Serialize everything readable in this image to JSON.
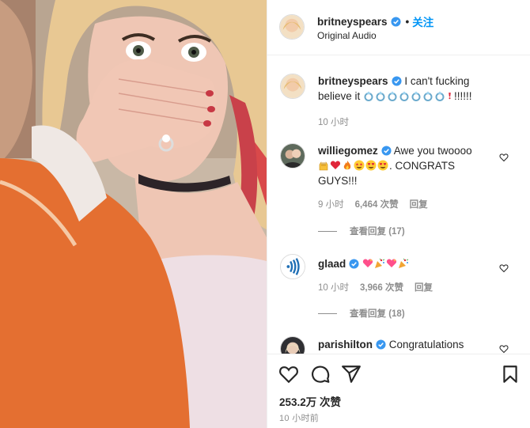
{
  "post": {
    "username": "britneyspears",
    "follow_label": "关注",
    "separator": "•",
    "audio_label": "Original Audio"
  },
  "comments": [
    {
      "user": "britneyspears",
      "text_prefix": "I can't fucking believe it ",
      "emoji": [
        "ring-icon",
        "ring-icon",
        "ring-icon",
        "ring-icon",
        "ring-icon",
        "ring-icon",
        "ring-icon",
        "exclamation-icon"
      ],
      "text_suffix": "!!!!!!",
      "time": "10 小时"
    },
    {
      "user": "williegomez",
      "text_prefix": "Awe you twoooo ",
      "emoji": [
        "raised-hands-icon",
        "red-heart-icon",
        "fire-icon",
        "star-struck-icon",
        "heart-eyes-icon",
        "heart-eyes-icon"
      ],
      "text_suffix": ". CONGRATS GUYS!!!",
      "time": "9 小时",
      "likes": "6,464 次赞",
      "reply": "回复",
      "view_replies": "查看回复 (17)"
    },
    {
      "user": "glaad",
      "text_prefix": "",
      "emoji": [
        "sparkling-heart-icon",
        "party-popper-icon",
        "sparkling-heart-icon",
        "party-popper-icon"
      ],
      "text_suffix": "",
      "time": "10 小时",
      "likes": "3,966 次赞",
      "reply": "回复",
      "view_replies": "查看回复 (18)"
    },
    {
      "user": "parishilton",
      "text_prefix": "Congratulations",
      "text_suffix": ""
    }
  ],
  "footer": {
    "likes": "253.2万 次赞",
    "time": "10 小时前"
  },
  "colors": {
    "accent": "#0095f6",
    "verified": "#3897f0",
    "muted": "#8e8e8e",
    "text": "#262626"
  }
}
